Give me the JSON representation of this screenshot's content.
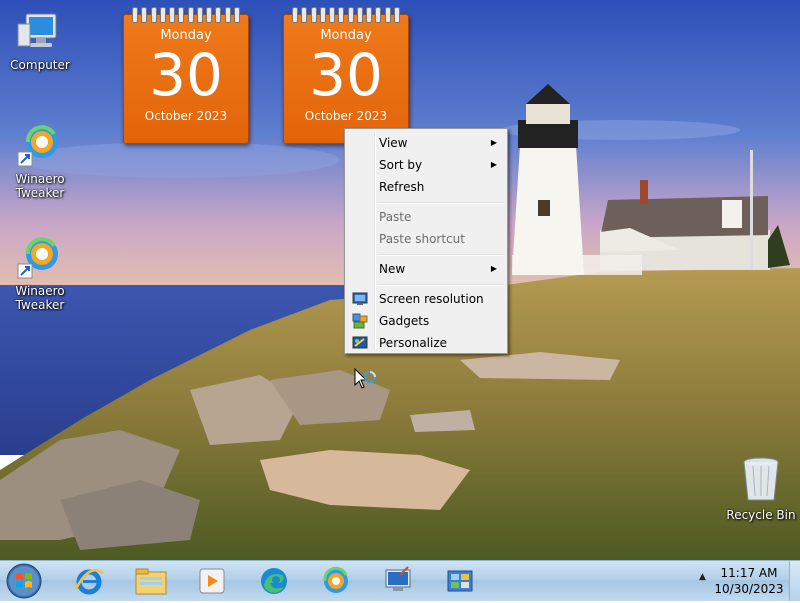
{
  "desktop": {
    "icons": [
      {
        "label": "Computer"
      },
      {
        "label": "Winaero\nTweaker"
      },
      {
        "label": "Winaero\nTweaker"
      }
    ],
    "recycle_bin": {
      "label": "Recycle Bin"
    }
  },
  "gadgets": [
    {
      "day": "Monday",
      "date": "30",
      "month": "October 2023"
    },
    {
      "day": "Monday",
      "date": "30",
      "month": "October 2023"
    }
  ],
  "context_menu": {
    "items": [
      {
        "label": "View",
        "submenu": true,
        "disabled": false
      },
      {
        "label": "Sort by",
        "submenu": true,
        "disabled": false
      },
      {
        "label": "Refresh",
        "submenu": false,
        "disabled": false
      },
      {
        "label": "Paste",
        "submenu": false,
        "disabled": true
      },
      {
        "label": "Paste shortcut",
        "submenu": false,
        "disabled": true
      },
      {
        "label": "New",
        "submenu": true,
        "disabled": false
      },
      {
        "label": "Screen resolution",
        "icon": "screen-resolution-icon",
        "disabled": false
      },
      {
        "label": "Gadgets",
        "icon": "gadgets-icon",
        "disabled": false
      },
      {
        "label": "Personalize",
        "icon": "personalize-icon",
        "disabled": false
      }
    ],
    "arrow": "▶"
  },
  "taskbar": {
    "pinned": [
      {
        "icon": "internet-explorer-icon"
      },
      {
        "icon": "file-explorer-icon"
      },
      {
        "icon": "media-player-icon"
      },
      {
        "icon": "edge-icon"
      },
      {
        "icon": "winaero-tweaker-icon"
      },
      {
        "icon": "remote-desktop-icon"
      },
      {
        "icon": "control-panel-icon"
      }
    ],
    "tray_arrow": "▲",
    "clock": {
      "time": "11:17 AM",
      "date": "10/30/2023"
    }
  },
  "colors": {
    "calendar": "#e8690f",
    "menu_bg": "#f0f0f0",
    "taskbar": "#b9d4ec"
  }
}
